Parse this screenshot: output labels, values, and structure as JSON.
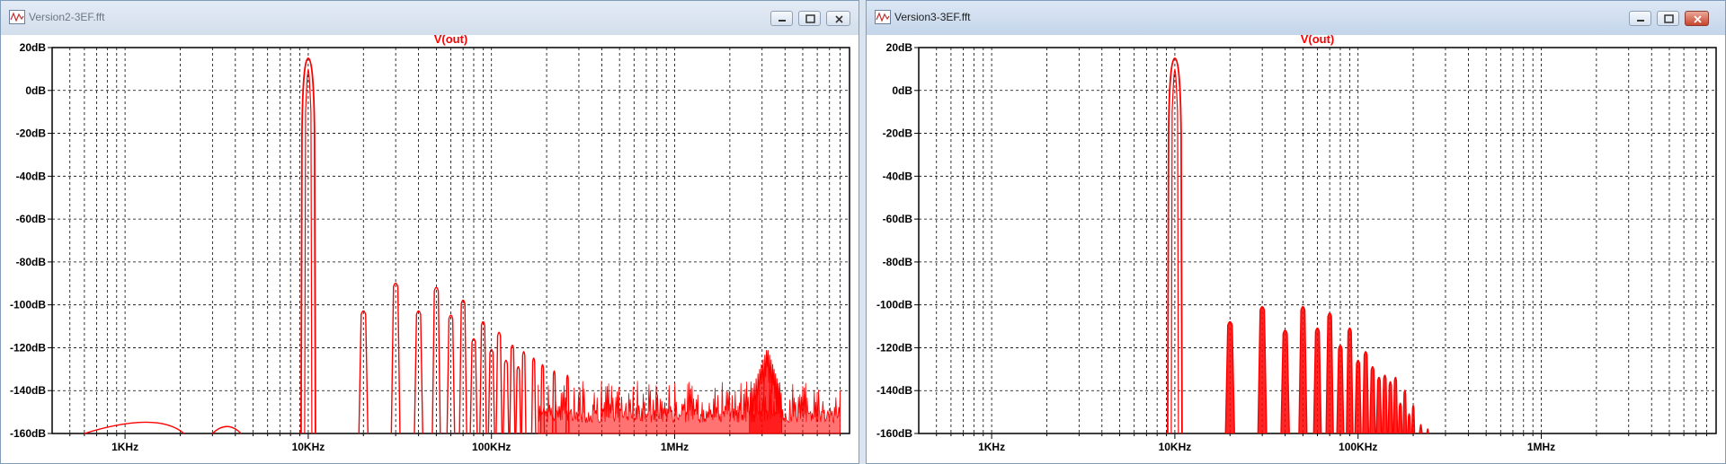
{
  "windows": [
    {
      "title": "Version2-3EF.fft",
      "active": false,
      "chart_data": {
        "type": "line",
        "title": "V(out)",
        "xscale": "log",
        "xlim_hz": [
          400,
          9000000
        ],
        "ylim_db": [
          -160,
          20
        ],
        "y_ticks": [
          "20dB",
          "0dB",
          "-20dB",
          "-40dB",
          "-60dB",
          "-80dB",
          "-100dB",
          "-120dB",
          "-140dB",
          "-160dB"
        ],
        "x_ticks": [
          {
            "hz": 1000,
            "label": "1KHz"
          },
          {
            "hz": 10000,
            "label": "10KHz"
          },
          {
            "hz": 100000,
            "label": "100KHz"
          },
          {
            "hz": 1000000,
            "label": "1MHz"
          }
        ],
        "grid": true,
        "line_color": "#ff0000",
        "series": [
          {
            "fundamental": {
              "hz": 10000,
              "db": 15
            },
            "harmonics": [
              {
                "hz": 20000,
                "db": -102
              },
              {
                "hz": 30000,
                "db": -89
              },
              {
                "hz": 40000,
                "db": -102
              },
              {
                "hz": 50000,
                "db": -91
              },
              {
                "hz": 60000,
                "db": -104
              },
              {
                "hz": 70000,
                "db": -97
              },
              {
                "hz": 80000,
                "db": -115
              },
              {
                "hz": 90000,
                "db": -107
              },
              {
                "hz": 100000,
                "db": -120
              },
              {
                "hz": 110000,
                "db": -112
              },
              {
                "hz": 120000,
                "db": -125
              },
              {
                "hz": 130000,
                "db": -118
              },
              {
                "hz": 140000,
                "db": -128
              },
              {
                "hz": 150000,
                "db": -121
              },
              {
                "hz": 170000,
                "db": -124
              },
              {
                "hz": 190000,
                "db": -127
              },
              {
                "hz": 220000,
                "db": -130
              },
              {
                "hz": 260000,
                "db": -132
              }
            ],
            "noise_floor": {
              "from_hz": 180000,
              "to_hz": 8000000,
              "db_min": -155,
              "db_max": -135
            },
            "spur": {
              "hz": 3200000,
              "db": -120
            },
            "low_bumps": [
              {
                "from_hz": 600,
                "peak_hz": 1500,
                "to_hz": 2100,
                "db": -152
              },
              {
                "from_hz": 3000,
                "peak_hz": 3600,
                "to_hz": 4300,
                "db": -156
              }
            ]
          }
        ]
      }
    },
    {
      "title": "Version3-3EF.fft",
      "active": true,
      "chart_data": {
        "type": "line",
        "title": "V(out)",
        "xscale": "log",
        "xlim_hz": [
          400,
          9000000
        ],
        "ylim_db": [
          -160,
          20
        ],
        "y_ticks": [
          "20dB",
          "0dB",
          "-20dB",
          "-40dB",
          "-60dB",
          "-80dB",
          "-100dB",
          "-120dB",
          "-140dB",
          "-160dB"
        ],
        "x_ticks": [
          {
            "hz": 1000,
            "label": "1KHz"
          },
          {
            "hz": 10000,
            "label": "10KHz"
          },
          {
            "hz": 100000,
            "label": "100KHz"
          },
          {
            "hz": 1000000,
            "label": "1MHz"
          }
        ],
        "grid": true,
        "line_color": "#ff0000",
        "series": [
          {
            "fundamental": {
              "hz": 10000,
              "db": 15
            },
            "harmonics": [
              {
                "hz": 20000,
                "db": -107
              },
              {
                "hz": 30000,
                "db": -100
              },
              {
                "hz": 40000,
                "db": -111
              },
              {
                "hz": 50000,
                "db": -100
              },
              {
                "hz": 60000,
                "db": -110
              },
              {
                "hz": 70000,
                "db": -103
              },
              {
                "hz": 80000,
                "db": -118
              },
              {
                "hz": 90000,
                "db": -110
              },
              {
                "hz": 100000,
                "db": -125
              },
              {
                "hz": 110000,
                "db": -121
              },
              {
                "hz": 120000,
                "db": -128
              },
              {
                "hz": 130000,
                "db": -133
              },
              {
                "hz": 140000,
                "db": -132
              },
              {
                "hz": 150000,
                "db": -135
              },
              {
                "hz": 160000,
                "db": -133
              },
              {
                "hz": 170000,
                "db": -145
              },
              {
                "hz": 180000,
                "db": -139
              },
              {
                "hz": 190000,
                "db": -150
              },
              {
                "hz": 200000,
                "db": -146
              },
              {
                "hz": 220000,
                "db": -155
              },
              {
                "hz": 240000,
                "db": -157
              }
            ]
          }
        ]
      }
    }
  ]
}
